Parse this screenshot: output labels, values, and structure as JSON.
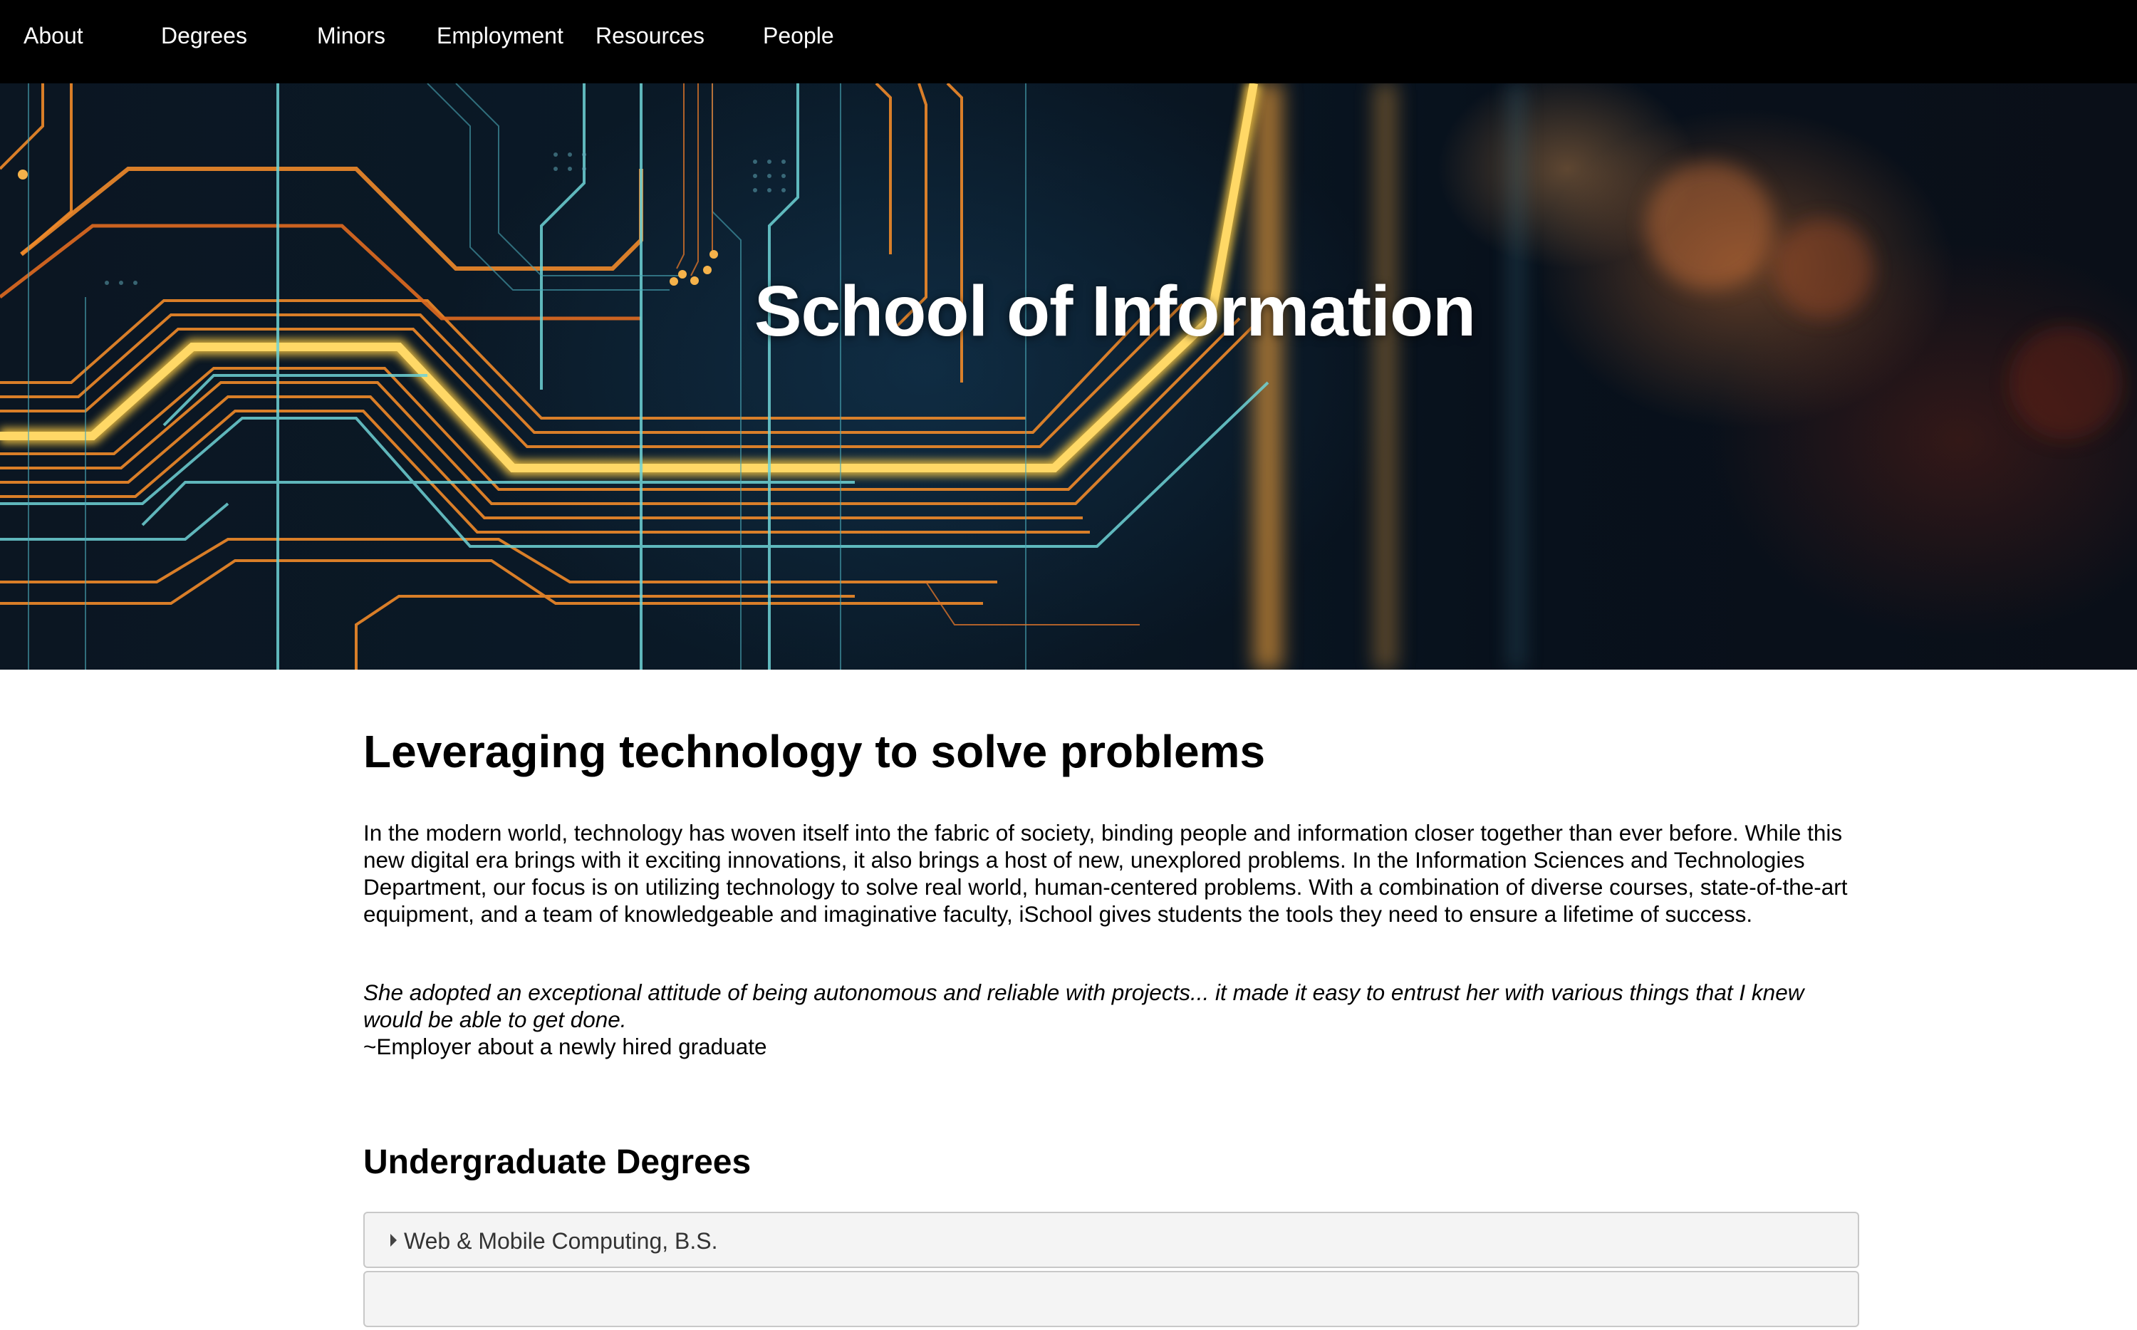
{
  "nav": {
    "items": [
      "About",
      "Degrees",
      "Minors",
      "Employment",
      "Resources",
      "People"
    ]
  },
  "hero": {
    "title": "School of Information",
    "image": "circuit-board-background"
  },
  "main": {
    "heading": "Leveraging technology to solve problems",
    "intro": "In the modern world, technology has woven itself into the fabric of society, binding people and information closer together than ever before. While this new digital era brings with it exciting innovations, it also brings a host of new, unexplored problems. In the Information Sciences and Technologies Department, our focus is on utilizing technology to solve real world, human-centered problems. With a combination of diverse courses, state-of-the-art equipment, and a team of knowledgeable and imaginative faculty, iSchool gives students the tools they need to ensure a lifetime of success.",
    "quote": "She adopted an exceptional attitude of being autonomous and reliable with projects... it made it easy to entrust her with various things that I knew would be able to get done.",
    "attribution": "~Employer about a newly hired graduate",
    "degrees_heading": "Undergraduate Degrees",
    "degrees": [
      "Web & Mobile Computing, B.S.",
      ""
    ]
  },
  "colors": {
    "nav_bg": "#000000",
    "accordion_bg": "#f4f4f4",
    "accordion_border": "#c8c8c8",
    "circuit_orange": "#f08a2a",
    "circuit_yellow": "#f5c542",
    "circuit_cyan": "#6fd3d6"
  }
}
